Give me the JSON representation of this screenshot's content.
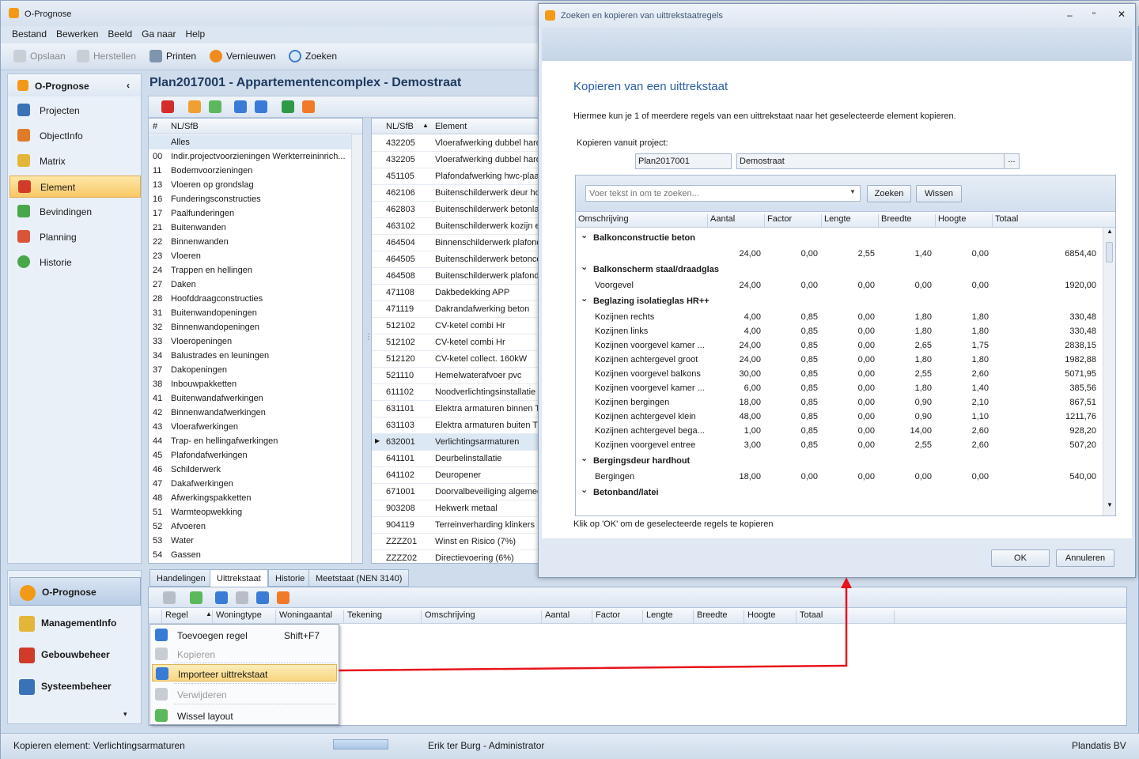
{
  "app": {
    "title": "O-Prognose"
  },
  "menu": [
    "Bestand",
    "Bewerken",
    "Beeld",
    "Ga naar",
    "Help"
  ],
  "toolbar": {
    "save": "Opslaan",
    "restore": "Herstellen",
    "print": "Printen",
    "refresh": "Vernieuwen",
    "search": "Zoeken"
  },
  "nav": {
    "header": "O-Prognose",
    "items": [
      "Projecten",
      "ObjectInfo",
      "Matrix",
      "Element",
      "Bevindingen",
      "Planning",
      "Historie"
    ],
    "selected": "Element"
  },
  "nav_bottom": [
    "O-Prognose",
    "ManagementInfo",
    "Gebouwbeheer",
    "Systeembeheer"
  ],
  "plan_title": "Plan2017001 - Appartementencomplex - Demostraat",
  "nlsfb_grid": {
    "headers": [
      "#",
      "NL/SfB"
    ],
    "rows": [
      [
        "",
        "Alles"
      ],
      [
        "00",
        "Indir.projectvoorzieningen Werkterreininrich..."
      ],
      [
        "11",
        "Bodemvoorzieningen"
      ],
      [
        "13",
        "Vloeren op grondslag"
      ],
      [
        "16",
        "Funderingsconstructies"
      ],
      [
        "17",
        "Paalfunderingen"
      ],
      [
        "21",
        "Buitenwanden"
      ],
      [
        "22",
        "Binnenwanden"
      ],
      [
        "23",
        "Vloeren"
      ],
      [
        "24",
        "Trappen en hellingen"
      ],
      [
        "27",
        "Daken"
      ],
      [
        "28",
        "Hoofddraagconstructies"
      ],
      [
        "31",
        "Buitenwandopeningen"
      ],
      [
        "32",
        "Binnenwandopeningen"
      ],
      [
        "33",
        "Vloeropeningen"
      ],
      [
        "34",
        "Balustrades en leuningen"
      ],
      [
        "37",
        "Dakopeningen"
      ],
      [
        "38",
        "Inbouwpakketten"
      ],
      [
        "41",
        "Buitenwandafwerkingen"
      ],
      [
        "42",
        "Binnenwandafwerkingen"
      ],
      [
        "43",
        "Vloerafwerkingen"
      ],
      [
        "44",
        "Trap- en hellingafwerkingen"
      ],
      [
        "45",
        "Plafondafwerkingen"
      ],
      [
        "46",
        "Schilderwerk"
      ],
      [
        "47",
        "Dakafwerkingen"
      ],
      [
        "48",
        "Afwerkingspakketten"
      ],
      [
        "51",
        "Warmteopwekking"
      ],
      [
        "52",
        "Afvoeren"
      ],
      [
        "53",
        "Water"
      ],
      [
        "54",
        "Gassen"
      ]
    ]
  },
  "element_grid": {
    "headers": [
      "NL/SfB",
      "Element"
    ],
    "rows": [
      [
        "432205",
        "Vloerafwerking dubbel hard"
      ],
      [
        "432205",
        "Vloerafwerking dubbel hard"
      ],
      [
        "451105",
        "Plafondafwerking hwc-plaat"
      ],
      [
        "462106",
        "Buitenschilderwerk deur hou"
      ],
      [
        "462803",
        "Buitenschilderwerk betonlat"
      ],
      [
        "463102",
        "Buitenschilderwerk kozijn e"
      ],
      [
        "464504",
        "Binnenschilderwerk plafond"
      ],
      [
        "464505",
        "Buitenschilderwerk betonco"
      ],
      [
        "464508",
        "Buitenschilderwerk plafond"
      ],
      [
        "471108",
        "Dakbedekking APP"
      ],
      [
        "471119",
        "Dakrandafwerking beton"
      ],
      [
        "512102",
        "CV-ketel combi Hr"
      ],
      [
        "512102",
        "CV-ketel combi Hr"
      ],
      [
        "512120",
        "CV-ketel collect. 160kW"
      ],
      [
        "521110",
        "Hemelwaterafvoer pvc"
      ],
      [
        "611102",
        "Noodverlichtingsinstallatie"
      ],
      [
        "631101",
        "Elektra armaturen binnen T"
      ],
      [
        "631103",
        "Elektra armaturen buiten TL"
      ],
      [
        "632001",
        "Verlichtingsarmaturen"
      ],
      [
        "641101",
        "Deurbelinstallatie"
      ],
      [
        "641102",
        "Deuropener"
      ],
      [
        "671001",
        "Doorvalbeveiliging algemee"
      ],
      [
        "903208",
        "Hekwerk metaal"
      ],
      [
        "904119",
        "Terreinverharding klinkers"
      ],
      [
        "ZZZZ01",
        "Winst en Risico (7%)"
      ],
      [
        "ZZZZ02",
        "Directievoering (6%)"
      ]
    ],
    "selected_index": 18
  },
  "tabs": [
    "Handelingen",
    "Uittrekstaat",
    "Historie",
    "Meetstaat (NEN 3140)"
  ],
  "selected_tab": "Uittrekstaat",
  "bottom_grid_headers": [
    "Regel",
    "Woningtype",
    "Woningaantal",
    "Tekening",
    "Omschrijving",
    "Aantal",
    "Factor",
    "Lengte",
    "Breedte",
    "Hoogte",
    "Totaal"
  ],
  "context_menu": {
    "items": [
      {
        "label": "Toevoegen regel",
        "shortcut": "Shift+F7",
        "enabled": true
      },
      {
        "label": "Kopieren",
        "shortcut": "",
        "enabled": false
      },
      {
        "label": "Importeer uittrekstaat",
        "shortcut": "",
        "enabled": true,
        "highlighted": true
      },
      {
        "label": "Verwijderen",
        "shortcut": "",
        "enabled": false
      },
      {
        "label": "Wissel layout",
        "shortcut": "",
        "enabled": true
      }
    ]
  },
  "status": {
    "left": "Kopieren element: Verlichtingsarmaturen",
    "user": "Erik ter Burg - Administrator",
    "company": "Plandatis BV"
  },
  "dialog": {
    "title": "Zoeken en kopieren van uittrekstaatregels",
    "heading": "Kopieren van een uittrekstaat",
    "description": "Hiermee kun je 1 of meerdere regels van een uittrekstaat naar het geselecteerde element kopieren.",
    "project_label": "Kopieren vanuit project:",
    "project_code": "Plan2017001",
    "project_name": "Demostraat",
    "browse": "...",
    "search_placeholder": "Voer tekst in om te zoeken...",
    "btn_search": "Zoeken",
    "btn_clear": "Wissen",
    "headers": [
      "Omschrijving",
      "Aantal",
      "Factor",
      "Lengte",
      "Breedte",
      "Hoogte",
      "Totaal"
    ],
    "rows": [
      {
        "group": "Balkonconstructie beton"
      },
      {
        "desc": "",
        "aantal": "24,00",
        "factor": "0,00",
        "lengte": "2,55",
        "breedte": "1,40",
        "hoogte": "0,00",
        "totaal": "6854,40"
      },
      {
        "group": "Balkonscherm staal/draadglas"
      },
      {
        "desc": "Voorgevel",
        "aantal": "24,00",
        "factor": "0,00",
        "lengte": "0,00",
        "breedte": "0,00",
        "hoogte": "0,00",
        "totaal": "1920,00"
      },
      {
        "group": "Beglazing isolatieglas HR++"
      },
      {
        "desc": "Kozijnen rechts",
        "aantal": "4,00",
        "factor": "0,85",
        "lengte": "0,00",
        "breedte": "1,80",
        "hoogte": "1,80",
        "totaal": "330,48"
      },
      {
        "desc": "Kozijnen links",
        "aantal": "4,00",
        "factor": "0,85",
        "lengte": "0,00",
        "breedte": "1,80",
        "hoogte": "1,80",
        "totaal": "330,48"
      },
      {
        "desc": "Kozijnen voorgevel kamer ...",
        "aantal": "24,00",
        "factor": "0,85",
        "lengte": "0,00",
        "breedte": "2,65",
        "hoogte": "1,75",
        "totaal": "2838,15"
      },
      {
        "desc": "Kozijnen achtergevel groot",
        "aantal": "24,00",
        "factor": "0,85",
        "lengte": "0,00",
        "breedte": "1,80",
        "hoogte": "1,80",
        "totaal": "1982,88"
      },
      {
        "desc": "Kozijnen voorgevel balkons",
        "aantal": "30,00",
        "factor": "0,85",
        "lengte": "0,00",
        "breedte": "2,55",
        "hoogte": "2,60",
        "totaal": "5071,95"
      },
      {
        "desc": "Kozijnen voorgevel kamer ...",
        "aantal": "6,00",
        "factor": "0,85",
        "lengte": "0,00",
        "breedte": "1,80",
        "hoogte": "1,40",
        "totaal": "385,56"
      },
      {
        "desc": "Kozijnen bergingen",
        "aantal": "18,00",
        "factor": "0,85",
        "lengte": "0,00",
        "breedte": "0,90",
        "hoogte": "2,10",
        "totaal": "867,51"
      },
      {
        "desc": "Kozijnen achtergevel klein",
        "aantal": "48,00",
        "factor": "0,85",
        "lengte": "0,00",
        "breedte": "0,90",
        "hoogte": "1,10",
        "totaal": "1211,76"
      },
      {
        "desc": "Kozijnen achtergevel bega...",
        "aantal": "1,00",
        "factor": "0,85",
        "lengte": "0,00",
        "breedte": "14,00",
        "hoogte": "2,60",
        "totaal": "928,20"
      },
      {
        "desc": "Kozijnen voorgevel entree",
        "aantal": "3,00",
        "factor": "0,85",
        "lengte": "0,00",
        "breedte": "2,55",
        "hoogte": "2,60",
        "totaal": "507,20"
      },
      {
        "group": "Bergingsdeur hardhout"
      },
      {
        "desc": "Bergingen",
        "aantal": "18,00",
        "factor": "0,00",
        "lengte": "0,00",
        "breedte": "0,00",
        "hoogte": "0,00",
        "totaal": "540,00"
      },
      {
        "group": "Betonband/latei"
      }
    ],
    "footer_note": "Klik op 'OK' om de geselecteerde regels te kopieren",
    "ok": "OK",
    "cancel": "Annuleren"
  },
  "colors": {
    "accent": "#2a5fa6",
    "arrow": "#e8141c",
    "selection": "#f9c865"
  }
}
